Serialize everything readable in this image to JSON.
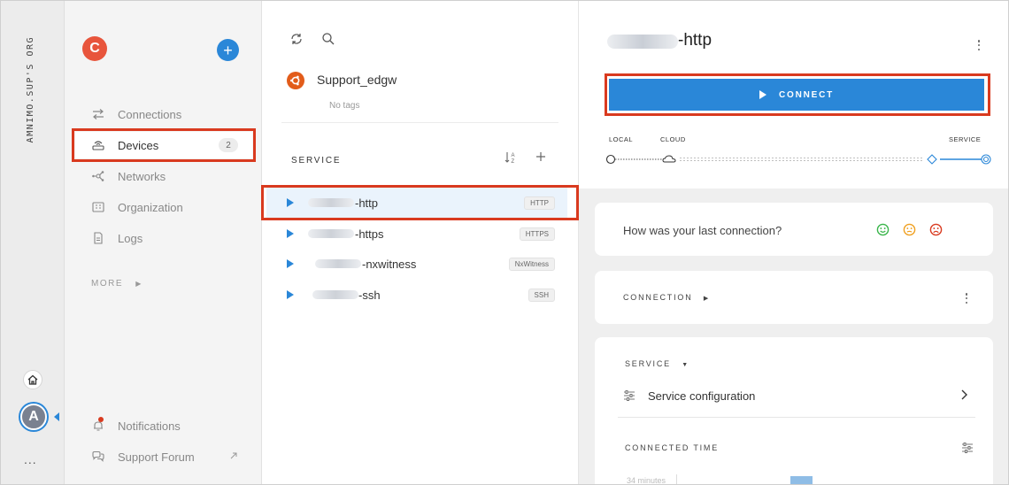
{
  "rail": {
    "org_label": "AMNIMO.SUP'S ORG",
    "avatar_letter": "A",
    "more": "..."
  },
  "nav": {
    "user_initial": "C",
    "add_label": "+",
    "items": [
      {
        "label": "Connections",
        "icon": "swap-arrows-icon"
      },
      {
        "label": "Devices",
        "icon": "router-icon",
        "badge": "2",
        "active": true
      },
      {
        "label": "Networks",
        "icon": "network-nodes-icon"
      },
      {
        "label": "Organization",
        "icon": "building-icon"
      },
      {
        "label": "Logs",
        "icon": "document-icon"
      }
    ],
    "more_label": "MORE",
    "bottom": [
      {
        "label": "Notifications",
        "icon": "bell-icon"
      },
      {
        "label": "Support Forum",
        "icon": "chat-icon"
      }
    ]
  },
  "device": {
    "name": "Support_edgw",
    "tags": "No tags",
    "os_icon": "ubuntu-icon"
  },
  "services": {
    "header": "SERVICE",
    "items": [
      {
        "name": "-http",
        "tag": "HTTP",
        "active": true
      },
      {
        "name": "-https",
        "tag": "HTTPS"
      },
      {
        "name": "-nxwitness",
        "tag": "NxWitness"
      },
      {
        "name": "-ssh",
        "tag": "SSH"
      }
    ]
  },
  "detail": {
    "title": "-http",
    "connect_label": "CONNECT",
    "route": {
      "local": "LOCAL",
      "cloud": "CLOUD",
      "service": "SERVICE"
    },
    "feedback_question": "How was your last connection?",
    "connection_label": "CONNECTION",
    "service_label": "SERVICE",
    "service_config": "Service configuration",
    "connected_time_label": "CONNECTED TIME",
    "minutes_label": "34 minutes"
  },
  "colors": {
    "accent": "#2a87d8",
    "highlight": "#d93a1f",
    "avatar_user": "#e8553c",
    "ubuntu": "#e25c1a",
    "face_good": "#39b54a",
    "face_neutral": "#f0a020",
    "face_bad": "#d93a1f"
  }
}
